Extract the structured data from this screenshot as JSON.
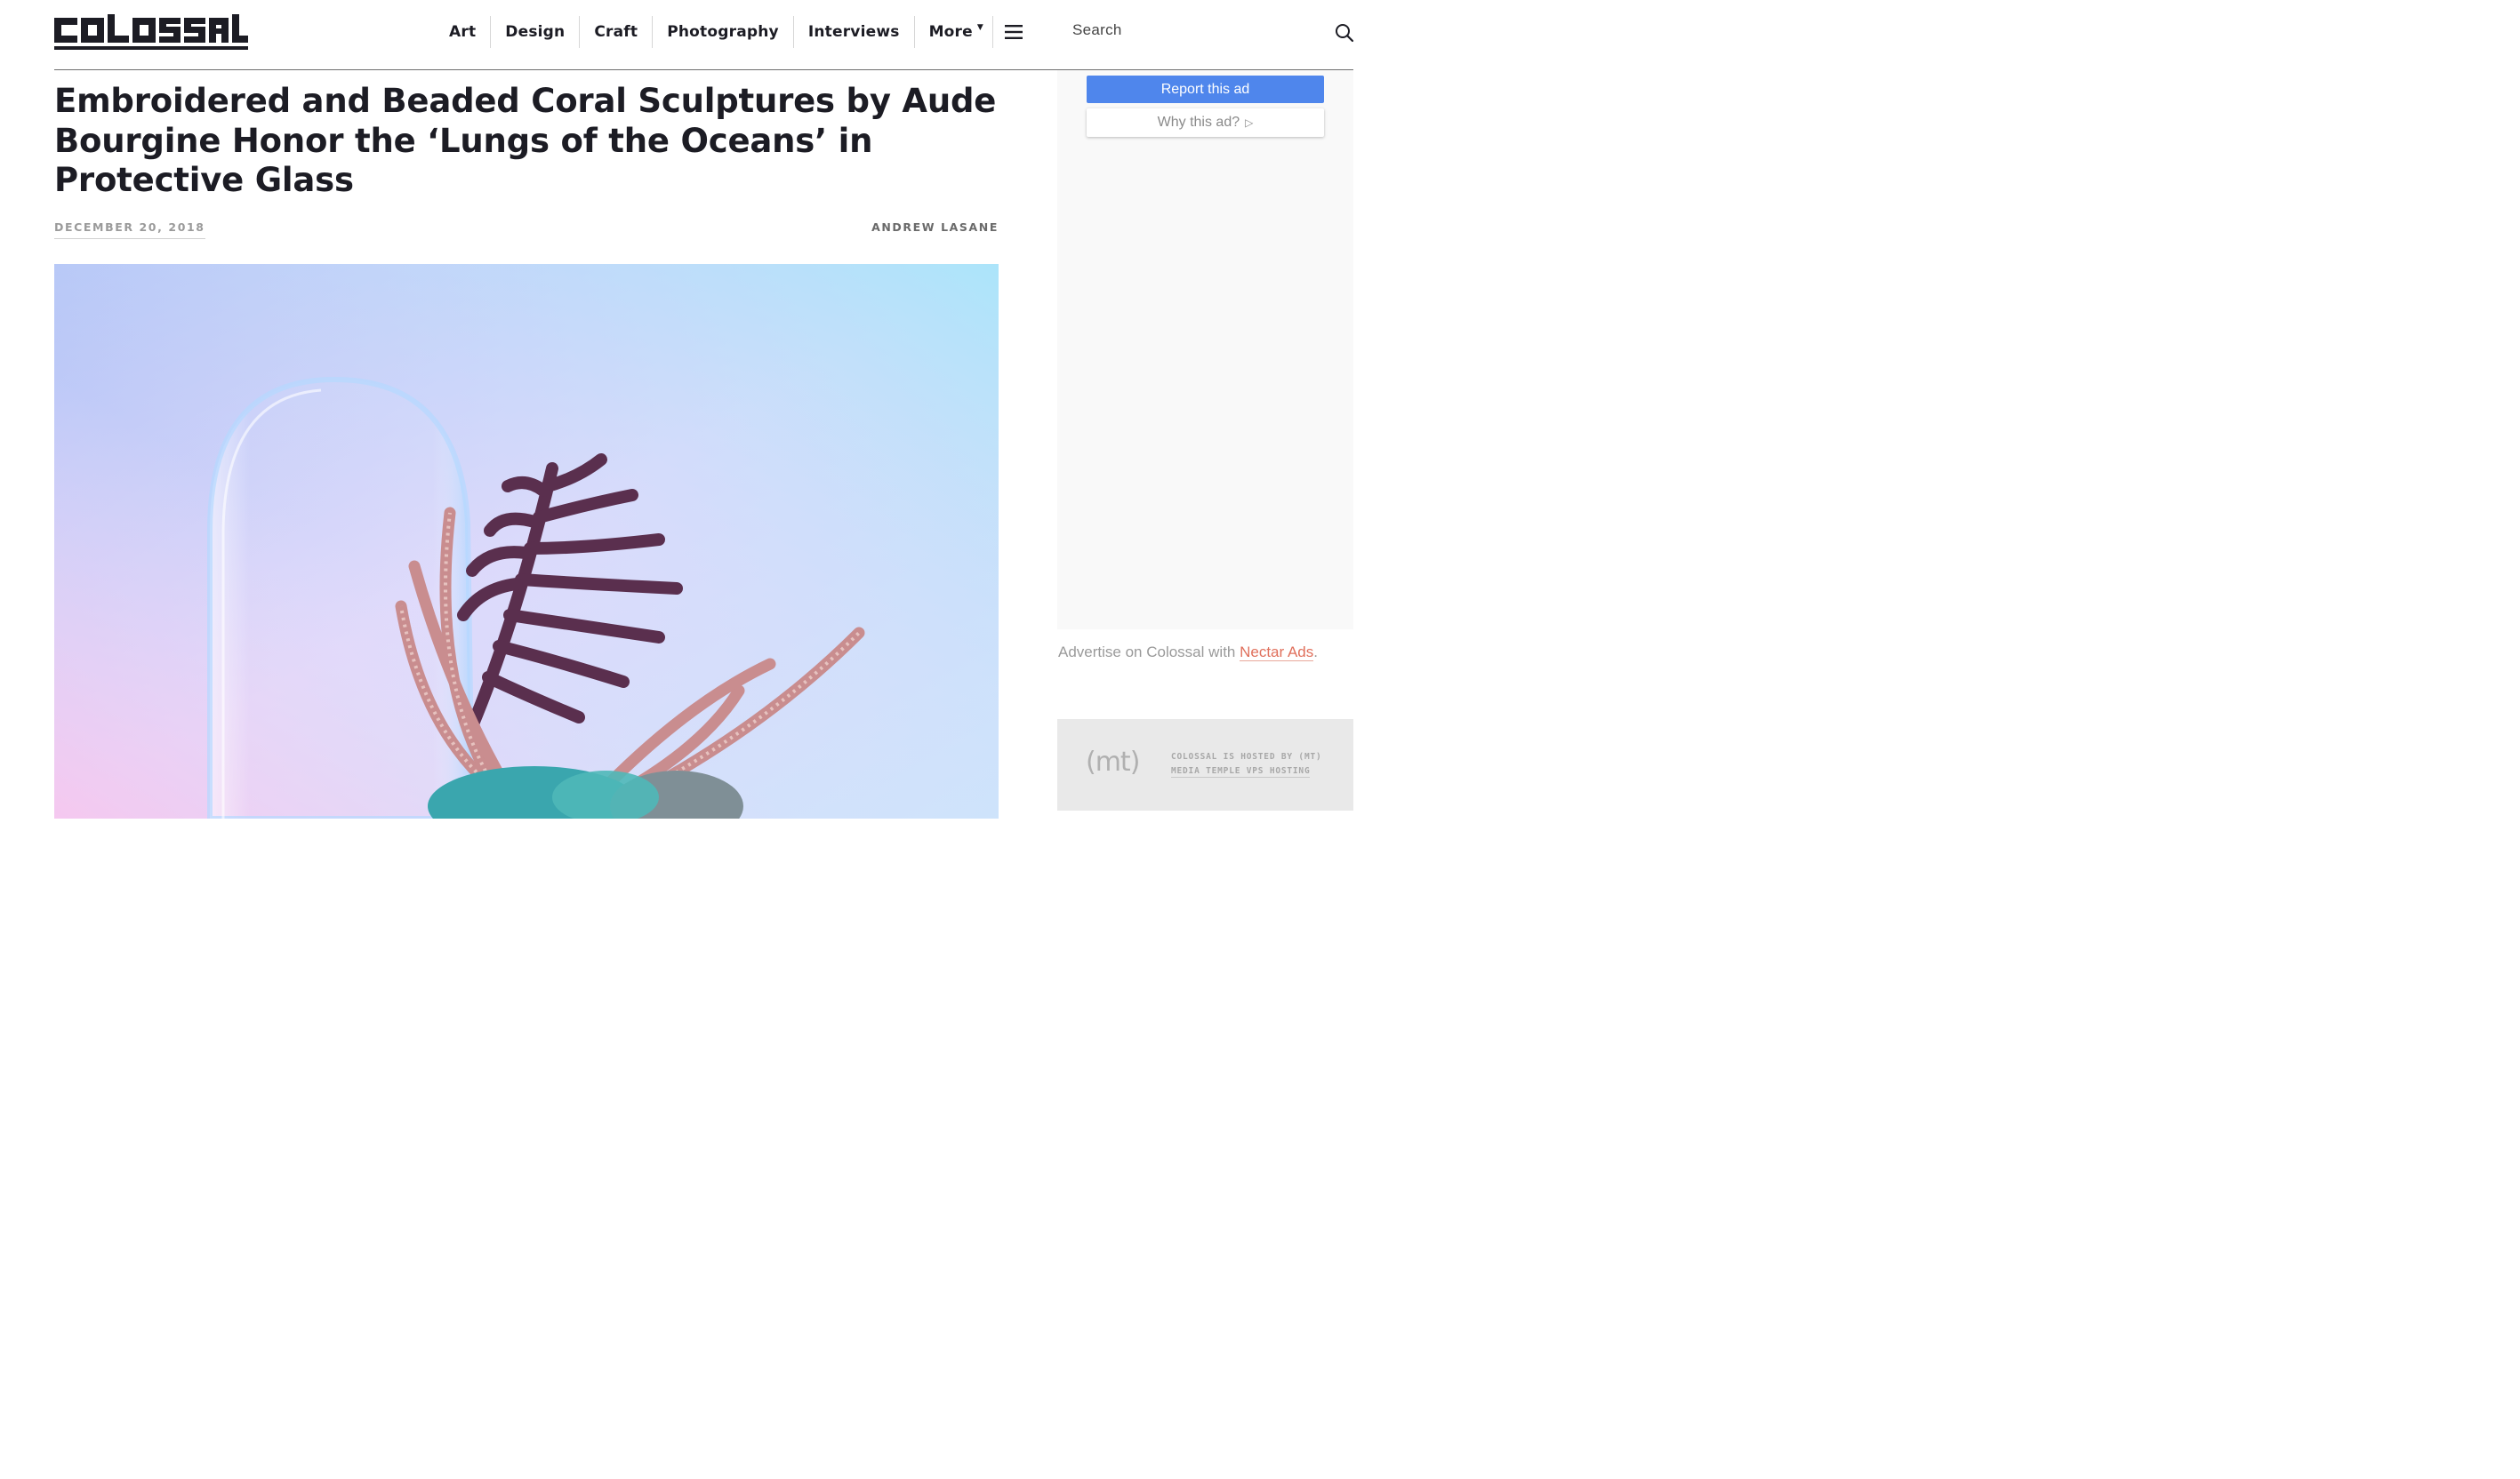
{
  "header": {
    "logo_text": "COLOSSAL",
    "nav": [
      {
        "label": "Art"
      },
      {
        "label": "Design"
      },
      {
        "label": "Craft"
      },
      {
        "label": "Photography"
      },
      {
        "label": "Interviews"
      },
      {
        "label": "More"
      }
    ],
    "menu_icon": "hamburger-icon",
    "search_label": "Search",
    "search_icon": "search-icon"
  },
  "article": {
    "title": "Embroidered and Beaded Coral Sculptures by Aude Bourgine Honor the ‘Lungs of the Oceans’ in Protective Glass",
    "date": "DECEMBER 20, 2018",
    "author": "ANDREW LASANE"
  },
  "sidebar": {
    "report_ad": "Report this ad",
    "why_ad": "Why this ad?",
    "advertise_prefix": "Advertise on Colossal with ",
    "advertise_link": "Nectar Ads",
    "advertise_suffix": ".",
    "host_logo": "(mt)",
    "host_line1": "COLOSSAL IS HOSTED BY (MT)",
    "host_line2": "MEDIA TEMPLE VPS HOSTING"
  },
  "colors": {
    "text_dark": "#1c1c24",
    "report_button": "#4f86ec",
    "link_accent": "#e0705c"
  }
}
